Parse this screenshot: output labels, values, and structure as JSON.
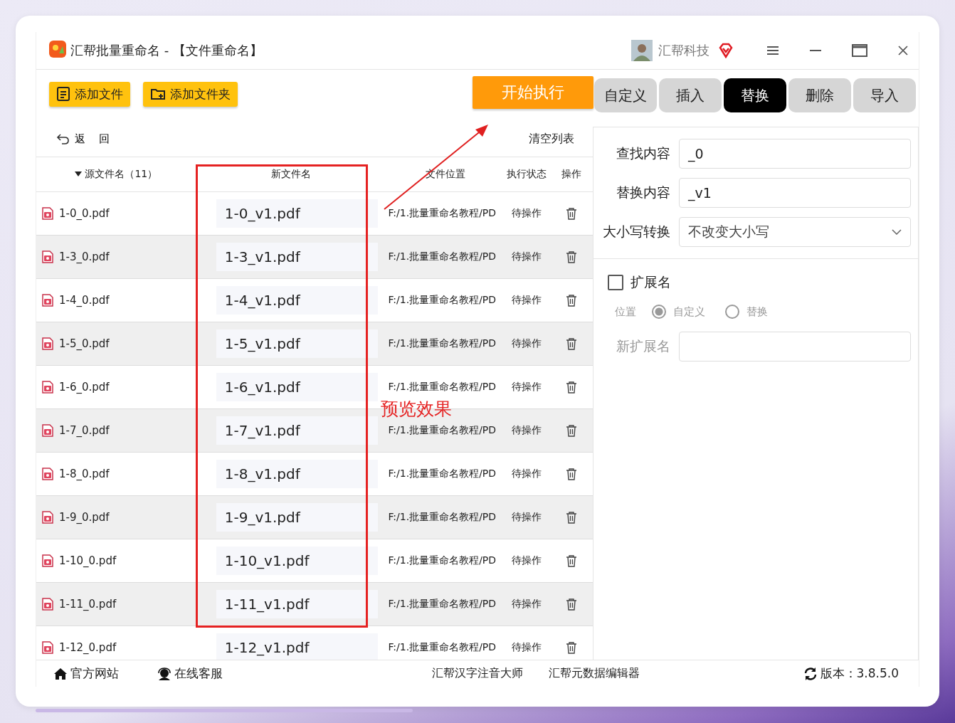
{
  "window": {
    "title": "汇帮批量重命名 - 【文件重命名】",
    "account": "汇帮科技"
  },
  "toolbar": {
    "buttons": [
      {
        "label": "添加文件",
        "kind": "file"
      },
      {
        "label": "添加文件夹",
        "kind": "folder"
      }
    ],
    "run_button": "开始执行"
  },
  "tabs": [
    {
      "label": "自定义",
      "selected": false
    },
    {
      "label": "插入",
      "selected": false
    },
    {
      "label": "替换",
      "selected": true
    },
    {
      "label": "删除",
      "selected": false
    },
    {
      "label": "导入",
      "selected": false
    }
  ],
  "list": {
    "back": "返 回",
    "clear": "清空列表",
    "columns": [
      "源文件名（11）",
      "新文件名",
      "文件位置",
      "执行状态",
      "操作"
    ],
    "rows": [
      {
        "source": "1-0_0.pdf",
        "new_name": "1-0_v1.pdf",
        "location": "F:/1.批量重命名教程/PD",
        "status": "待操作"
      },
      {
        "source": "1-3_0.pdf",
        "new_name": "1-3_v1.pdf",
        "location": "F:/1.批量重命名教程/PD",
        "status": "待操作"
      },
      {
        "source": "1-4_0.pdf",
        "new_name": "1-4_v1.pdf",
        "location": "F:/1.批量重命名教程/PD",
        "status": "待操作"
      },
      {
        "source": "1-5_0.pdf",
        "new_name": "1-5_v1.pdf",
        "location": "F:/1.批量重命名教程/PD",
        "status": "待操作"
      },
      {
        "source": "1-6_0.pdf",
        "new_name": "1-6_v1.pdf",
        "location": "F:/1.批量重命名教程/PD",
        "status": "待操作"
      },
      {
        "source": "1-7_0.pdf",
        "new_name": "1-7_v1.pdf",
        "location": "F:/1.批量重命名教程/PD",
        "status": "待操作"
      },
      {
        "source": "1-8_0.pdf",
        "new_name": "1-8_v1.pdf",
        "location": "F:/1.批量重命名教程/PD",
        "status": "待操作"
      },
      {
        "source": "1-9_0.pdf",
        "new_name": "1-9_v1.pdf",
        "location": "F:/1.批量重命名教程/PD",
        "status": "待操作"
      },
      {
        "source": "1-10_0.pdf",
        "new_name": "1-10_v1.pdf",
        "location": "F:/1.批量重命名教程/PD",
        "status": "待操作"
      },
      {
        "source": "1-11_0.pdf",
        "new_name": "1-11_v1.pdf",
        "location": "F:/1.批量重命名教程/PD",
        "status": "待操作"
      },
      {
        "source": "1-12_0.pdf",
        "new_name": "1-12_v1.pdf",
        "location": "F:/1.批量重命名教程/PD",
        "status": "待操作"
      }
    ]
  },
  "replace_form": {
    "find_label": "查找内容",
    "find_value": "_0",
    "replace_label": "替换内容",
    "replace_value": "_v1",
    "case_label": "大小写转换",
    "case_value": "不改变大小写"
  },
  "extension": {
    "label": "扩展名",
    "checked": false,
    "position_label": "位置",
    "options": [
      {
        "label": "自定义",
        "selected": true
      },
      {
        "label": "替换",
        "selected": false
      }
    ],
    "new_ext_label": "新扩展名"
  },
  "footer": {
    "links": [
      {
        "label": "官方网站",
        "kind": "home"
      },
      {
        "label": "在线客服",
        "kind": "support"
      },
      {
        "label": "汇帮汉字注音大师",
        "kind": "text"
      },
      {
        "label": "汇帮元数据编辑器",
        "kind": "text"
      }
    ],
    "version": "版本：3.8.5.0"
  },
  "annotation": {
    "label": "预览效果"
  }
}
